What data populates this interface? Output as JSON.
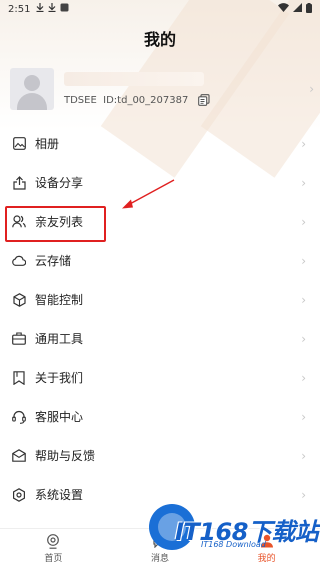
{
  "status_bar": {
    "time": "2:51",
    "left_icons": [
      "download-icon",
      "download-icon",
      "app-icon"
    ],
    "right_icons": [
      "wifi-icon",
      "signal-icon",
      "battery-icon"
    ]
  },
  "header": {
    "title": "我的"
  },
  "profile": {
    "id_text": "TDSEE  ID:td_00_207387",
    "copy_icon": "copy-icon",
    "avatar_icon": "avatar-placeholder-icon"
  },
  "menu": {
    "items": [
      {
        "label": "相册",
        "icon": "album-icon"
      },
      {
        "label": "设备分享",
        "icon": "share-icon"
      },
      {
        "label": "亲友列表",
        "icon": "friends-icon"
      },
      {
        "label": "云存储",
        "icon": "cloud-icon"
      },
      {
        "label": "智能控制",
        "icon": "cube-icon"
      },
      {
        "label": "通用工具",
        "icon": "toolbox-icon"
      },
      {
        "label": "关于我们",
        "icon": "bookmark-icon"
      },
      {
        "label": "客服中心",
        "icon": "headset-icon"
      },
      {
        "label": "帮助与反馈",
        "icon": "feedback-icon"
      },
      {
        "label": "系统设置",
        "icon": "settings-icon"
      }
    ],
    "chevron": "›"
  },
  "annotation": {
    "highlight_color": "#e02020"
  },
  "bottom_nav": {
    "items": [
      {
        "label": "首页",
        "icon": "camera-home-icon"
      },
      {
        "label": "消息",
        "icon": "message-icon"
      },
      {
        "label": "我的",
        "icon": "profile-icon"
      }
    ],
    "active_index": 2,
    "active_color": "#e8542a"
  },
  "watermark": {
    "main": "IT168下载站",
    "sub": "IT168 Download"
  }
}
